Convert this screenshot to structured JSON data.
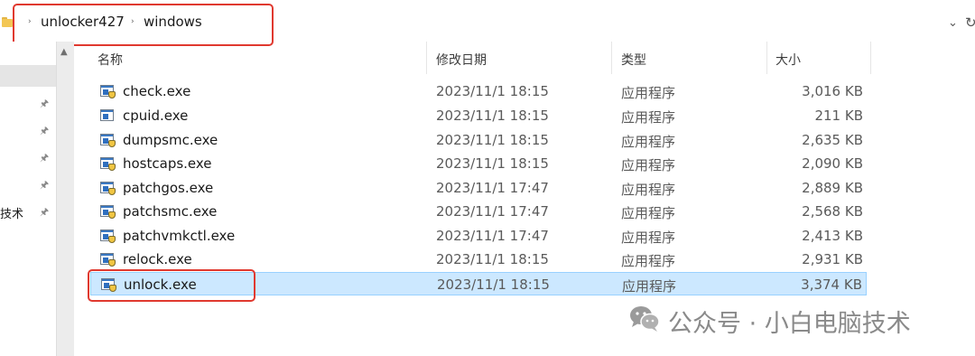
{
  "address_bar": {
    "crumbs": [
      "unlocker427",
      "windows"
    ],
    "separator": "›"
  },
  "nav": {
    "partial_label": "技术"
  },
  "columns": {
    "name": "名称",
    "date": "修改日期",
    "type": "类型",
    "size": "大小"
  },
  "files": [
    {
      "name": "check.exe",
      "date": "2023/11/1 18:15",
      "type": "应用程序",
      "size": "3,016 KB"
    },
    {
      "name": "cpuid.exe",
      "date": "2023/11/1 18:15",
      "type": "应用程序",
      "size": "211 KB"
    },
    {
      "name": "dumpsmc.exe",
      "date": "2023/11/1 18:15",
      "type": "应用程序",
      "size": "2,635 KB"
    },
    {
      "name": "hostcaps.exe",
      "date": "2023/11/1 18:15",
      "type": "应用程序",
      "size": "2,090 KB"
    },
    {
      "name": "patchgos.exe",
      "date": "2023/11/1 17:47",
      "type": "应用程序",
      "size": "2,889 KB"
    },
    {
      "name": "patchsmc.exe",
      "date": "2023/11/1 17:47",
      "type": "应用程序",
      "size": "2,568 KB"
    },
    {
      "name": "patchvmkctl.exe",
      "date": "2023/11/1 17:47",
      "type": "应用程序",
      "size": "2,413 KB"
    },
    {
      "name": "relock.exe",
      "date": "2023/11/1 18:15",
      "type": "应用程序",
      "size": "2,931 KB"
    },
    {
      "name": "unlock.exe",
      "date": "2023/11/1 18:15",
      "type": "应用程序",
      "size": "3,374 KB"
    }
  ],
  "watermark": {
    "text": "公众号 · 小白电脑技术"
  },
  "colors": {
    "selection": "#cce8ff",
    "annotation": "#e0392f"
  }
}
